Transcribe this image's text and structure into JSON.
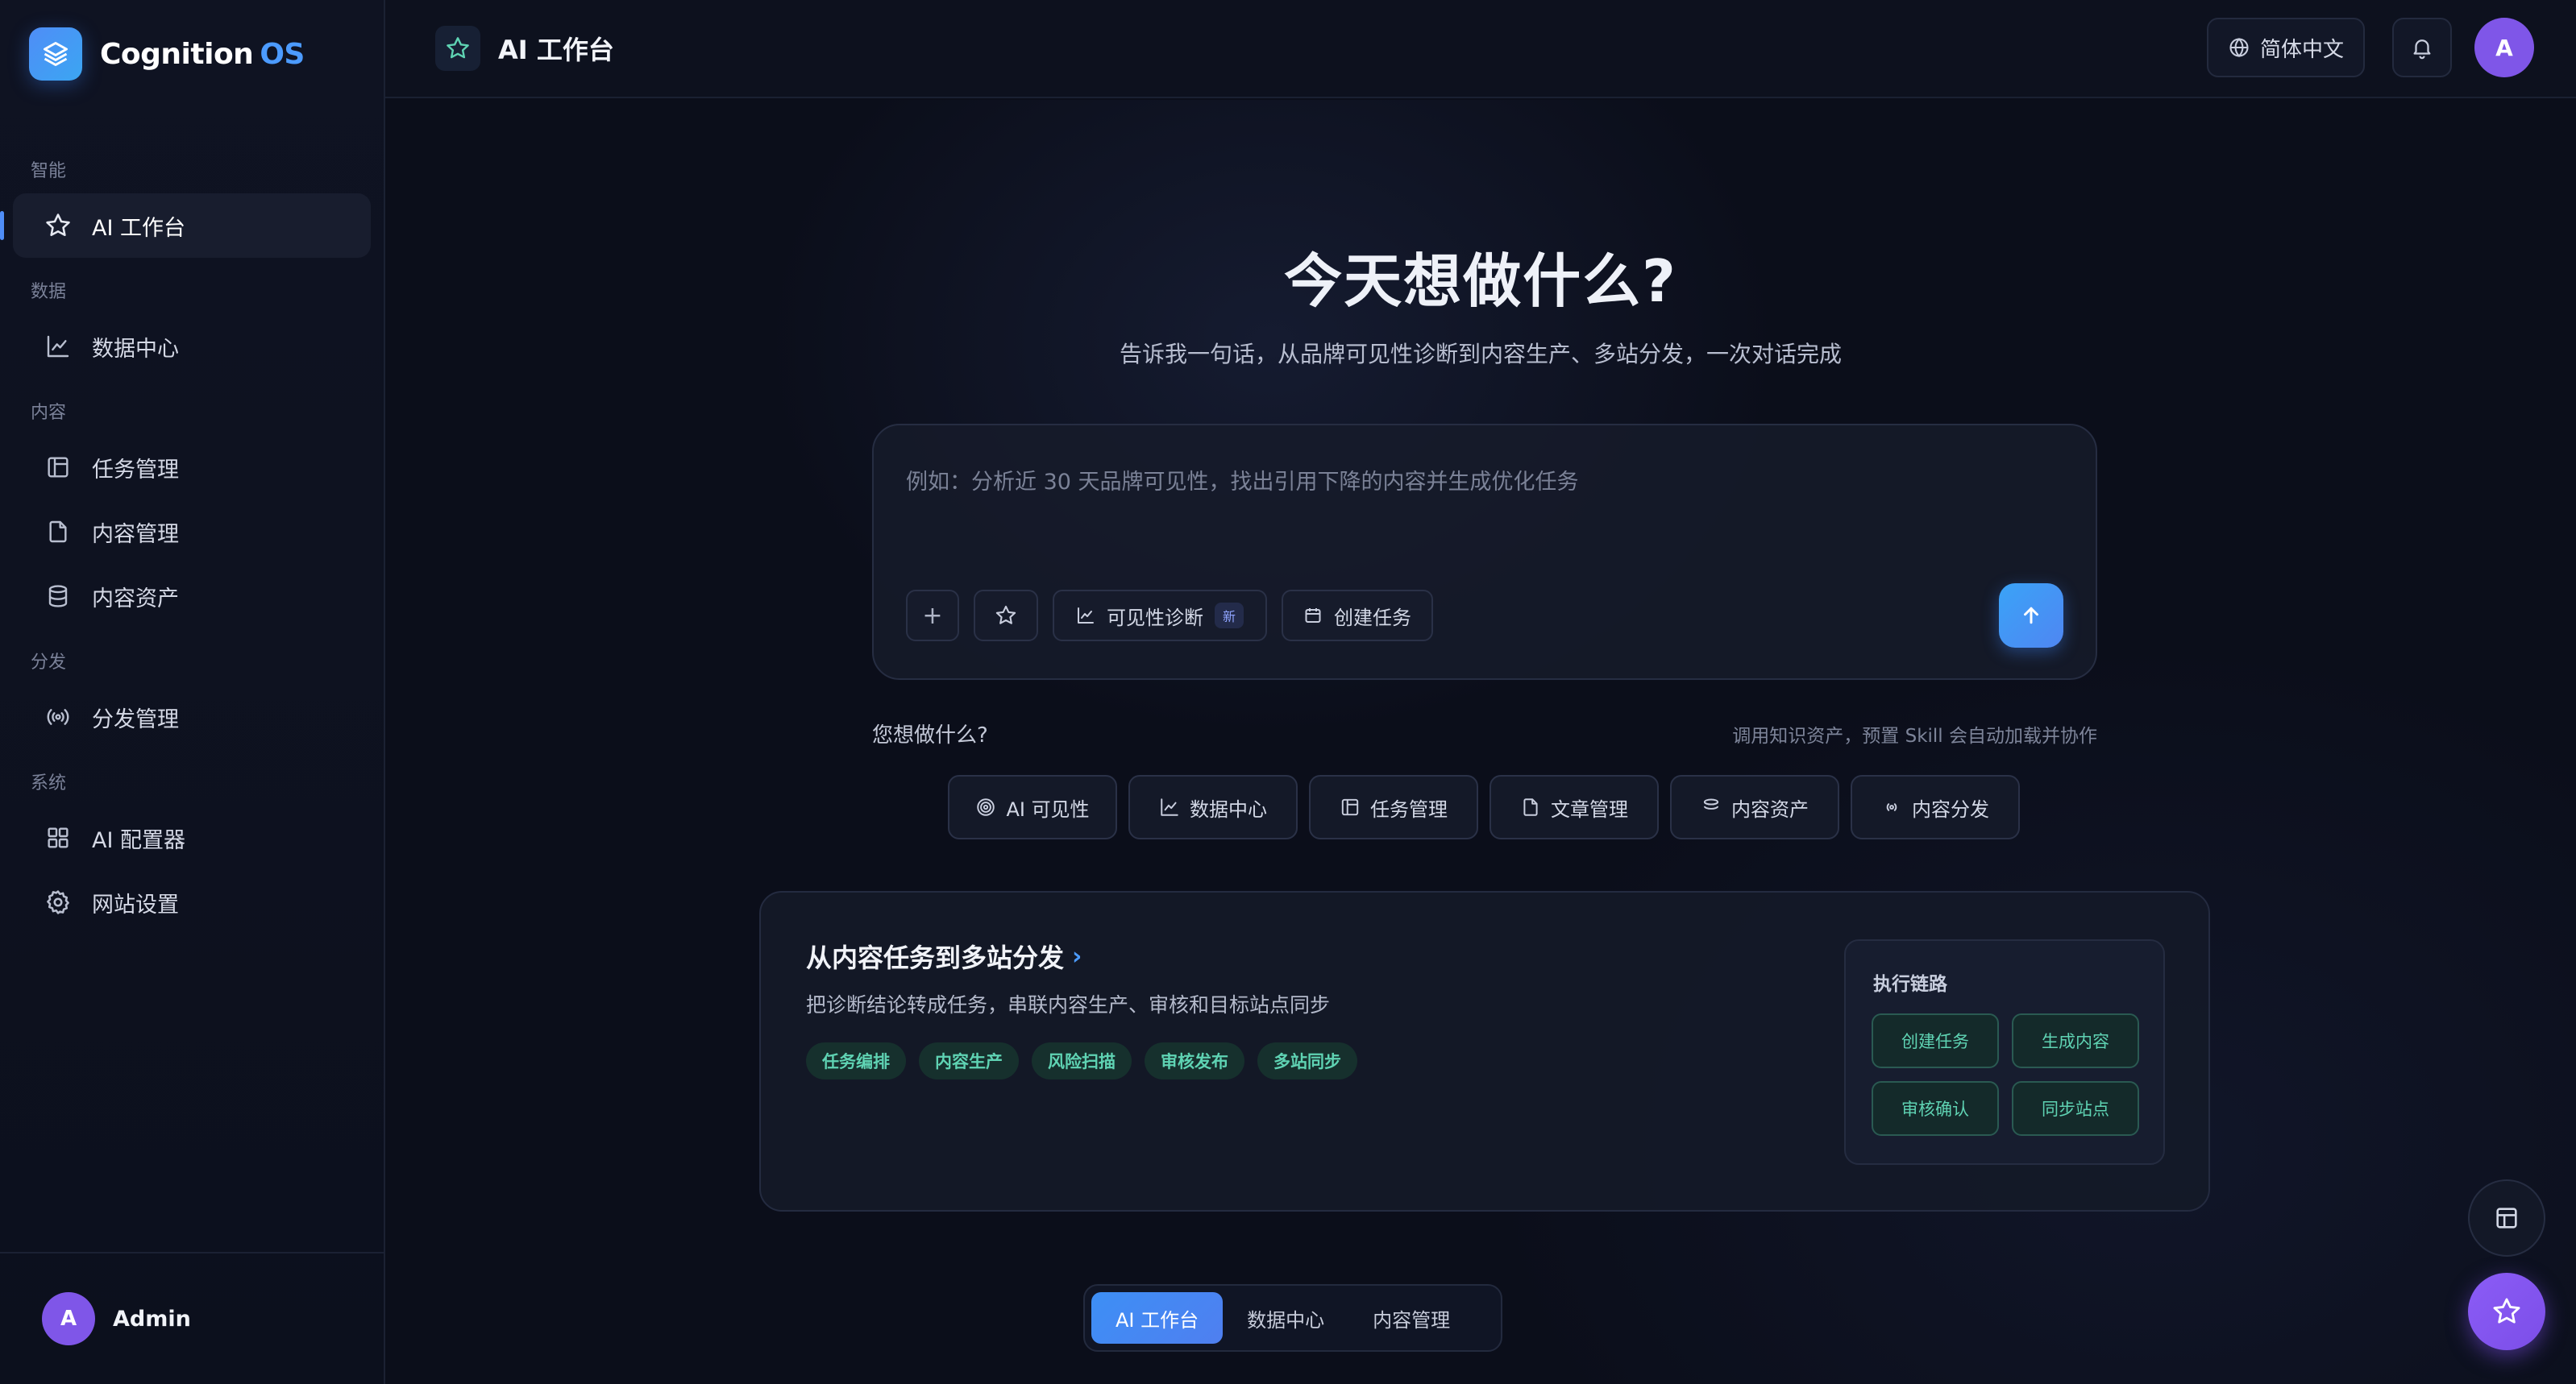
{
  "brand": {
    "name": "Cognition",
    "suffix": "OS",
    "logo_icon": "layers-icon"
  },
  "sidebar": {
    "sections": [
      {
        "label": "智能",
        "items": [
          {
            "label": "AI 工作台",
            "icon": "star-icon",
            "active": true
          }
        ]
      },
      {
        "label": "数据",
        "items": [
          {
            "label": "数据中心",
            "icon": "line-chart-icon"
          }
        ]
      },
      {
        "label": "内容",
        "items": [
          {
            "label": "任务管理",
            "icon": "layout-icon"
          },
          {
            "label": "内容管理",
            "icon": "file-icon"
          },
          {
            "label": "内容资产",
            "icon": "database-icon"
          }
        ]
      },
      {
        "label": "分发",
        "items": [
          {
            "label": "分发管理",
            "icon": "broadcast-icon"
          }
        ]
      },
      {
        "label": "系统",
        "items": [
          {
            "label": "AI 配置器",
            "icon": "grid-icon"
          },
          {
            "label": "网站设置",
            "icon": "gear-icon"
          }
        ]
      }
    ],
    "user": {
      "initial": "A",
      "name": "Admin"
    }
  },
  "topbar": {
    "title": "AI 工作台",
    "language": "简体中文",
    "avatar_initial": "A"
  },
  "hero": {
    "title": "今天想做什么?",
    "subtitle": "告诉我一句话，从品牌可见性诊断到内容生产、多站分发，一次对话完成"
  },
  "composer": {
    "placeholder": "例如：分析近 30 天品牌可见性，找出引用下降的内容并生成优化任务",
    "value": "",
    "plus_label": "+",
    "diagnose_label": "可见性诊断",
    "diagnose_badge": "新",
    "task_label": "创建任务"
  },
  "ask": {
    "label": "您想做什么?",
    "hint": "调用知识资产，预置 Skill 会自动加载并协作"
  },
  "quick_actions": [
    {
      "label": "AI 可见性",
      "icon": "target-icon"
    },
    {
      "label": "数据中心",
      "icon": "line-chart-icon"
    },
    {
      "label": "任务管理",
      "icon": "layout-icon"
    },
    {
      "label": "文章管理",
      "icon": "file-icon"
    },
    {
      "label": "内容资产",
      "icon": "database-icon"
    },
    {
      "label": "内容分发",
      "icon": "broadcast-icon"
    }
  ],
  "flow_card": {
    "title": "从内容任务到多站分发",
    "arrow": "›",
    "description": "把诊断结论转成任务，串联内容生产、审核和目标站点同步",
    "tags": [
      "任务编排",
      "内容生产",
      "风险扫描",
      "审核发布",
      "多站同步"
    ],
    "chain_title": "执行链路",
    "chain_steps": [
      "创建任务",
      "生成内容",
      "审核确认",
      "同步站点"
    ]
  },
  "bottom_tabs": [
    {
      "label": "AI 工作台",
      "active": true
    },
    {
      "label": "数据中心",
      "active": false
    },
    {
      "label": "内容管理",
      "active": false
    }
  ],
  "colors": {
    "accent": "#4f8df7",
    "purple": "#7f56e8",
    "teal": "#5fd3b3",
    "background": "#0b0e1a"
  }
}
